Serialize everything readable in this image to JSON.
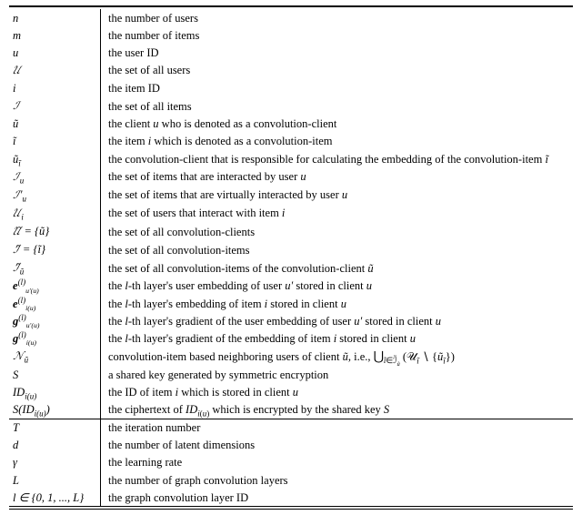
{
  "rows_a": [
    {
      "sym": "<i>n</i>",
      "desc": "the number of users"
    },
    {
      "sym": "<i>m</i>",
      "desc": "the number of items"
    },
    {
      "sym": "<i>u</i>",
      "desc": "the user ID"
    },
    {
      "sym": "<span class='cal'>𝒰</span>",
      "desc": "the set of all users"
    },
    {
      "sym": "<i>i</i>",
      "desc": "the item ID"
    },
    {
      "sym": "<span class='cal'>ℐ</span>",
      "desc": "the set of all items"
    },
    {
      "sym": "<i>ũ</i>",
      "desc": "the client <i>u</i> who is denoted as a convolution-client"
    },
    {
      "sym": "<i>ĩ</i>",
      "desc": "the item <i>i</i> which is denoted as a convolution-item"
    },
    {
      "sym": "<i>ũ<sub>ĩ</sub></i>",
      "desc": "the convolution-client that is responsible for calculating the embedding of the convolution-item <i>ĩ</i>"
    },
    {
      "sym": "<span class='cal'>ℐ</span><sub><i>u</i></sub>",
      "desc": "the set of items that are interacted by user <i>u</i>"
    },
    {
      "sym": "<span class='cal'>ℐ</span>′<sub><i>u</i></sub>",
      "desc": "the set of items that are virtually interacted by user <i>u</i>"
    },
    {
      "sym": "<span class='cal'>𝒰</span><sub><i>i</i></sub>",
      "desc": "the set of users that interact with item <i>i</i>"
    },
    {
      "sym": "<span class='cal'>𝒰̃</span> = {<i>ũ</i>}",
      "desc": "the set of all convolution-clients"
    },
    {
      "sym": "<span class='cal'>ℐ̃</span> = {<i>ĩ</i>}",
      "desc": "the set of all convolution-items"
    },
    {
      "sym": "<span class='cal'>ℐ̃</span><sub><i>ũ</i></sub>",
      "desc": "the set of all convolution-items of the convolution-client <i>ũ</i>"
    },
    {
      "sym": "<b><i>e</i></b><sup>(<i>l</i>)</sup><span class='sub2'><i>u′</i>(<i>u</i>)</span>",
      "desc": "the <i>l</i>-th layer's user embedding of user <i>u′</i> stored in client <i>u</i>"
    },
    {
      "sym": "<b><i>e</i></b><sup>(<i>l</i>)</sup><span class='sub2'><i>i</i>(<i>u</i>)</span>",
      "desc": "the <i>l</i>-th layer's embedding of item <i>i</i> stored in client <i>u</i>"
    },
    {
      "sym": "<b><i>g</i></b><sup>(<i>l</i>)</sup><span class='sub2'><i>u′</i>(<i>u</i>)</span>",
      "desc": "the <i>l</i>-th layer's gradient of the user embedding of user <i>u′</i> stored in client <i>u</i>"
    },
    {
      "sym": "<b><i>g</i></b><sup>(<i>l</i>)</sup><span class='sub2'><i>i</i>(<i>u</i>)</span>",
      "desc": "the <i>l</i>-th layer's gradient of the embedding of item <i>i</i> stored in client <i>u</i>"
    },
    {
      "sym": "<span class='cal'>𝒩</span><sub><i>ũ</i></sub>",
      "desc": "convolution-item based neighboring users of client <i>ũ</i>, i.e., <span class='bigcup'>⋃</span><sub><i>ĩ</i>∈<span class='cal'>ℐ̃</span><sub><i>ũ</i></sub></sub> (<span class='cal'>𝒰</span><sub><i>ĩ</i></sub> ∖ {<i>ũ<sub>ĩ</sub></i>})"
    },
    {
      "sym": "<i>S</i>",
      "desc": "a shared key generated by symmetric encryption"
    },
    {
      "sym": "<i>ID</i><sub><i>i</i>(<i>u</i>)</sub>",
      "desc": "the ID of item <i>i</i> which is stored in client <i>u</i>"
    },
    {
      "sym": "<i>S</i>(<i>ID</i><sub><i>i</i>(<i>u</i>)</sub>)",
      "desc": "the ciphertext of <i>ID</i><sub><i>i</i>(<i>u</i>)</sub> which is encrypted by the shared key <i>S</i>"
    }
  ],
  "rows_b": [
    {
      "sym": "<i>T</i>",
      "desc": "the iteration number"
    },
    {
      "sym": "<i>d</i>",
      "desc": "the number of latent dimensions"
    },
    {
      "sym": "<i>γ</i>",
      "desc": "the learning rate"
    },
    {
      "sym": "<i>L</i>",
      "desc": "the number of graph convolution layers"
    },
    {
      "sym": "<i>l</i> ∈ {0, 1, ..., <i>L</i>}",
      "desc": "the graph convolution layer ID"
    }
  ]
}
